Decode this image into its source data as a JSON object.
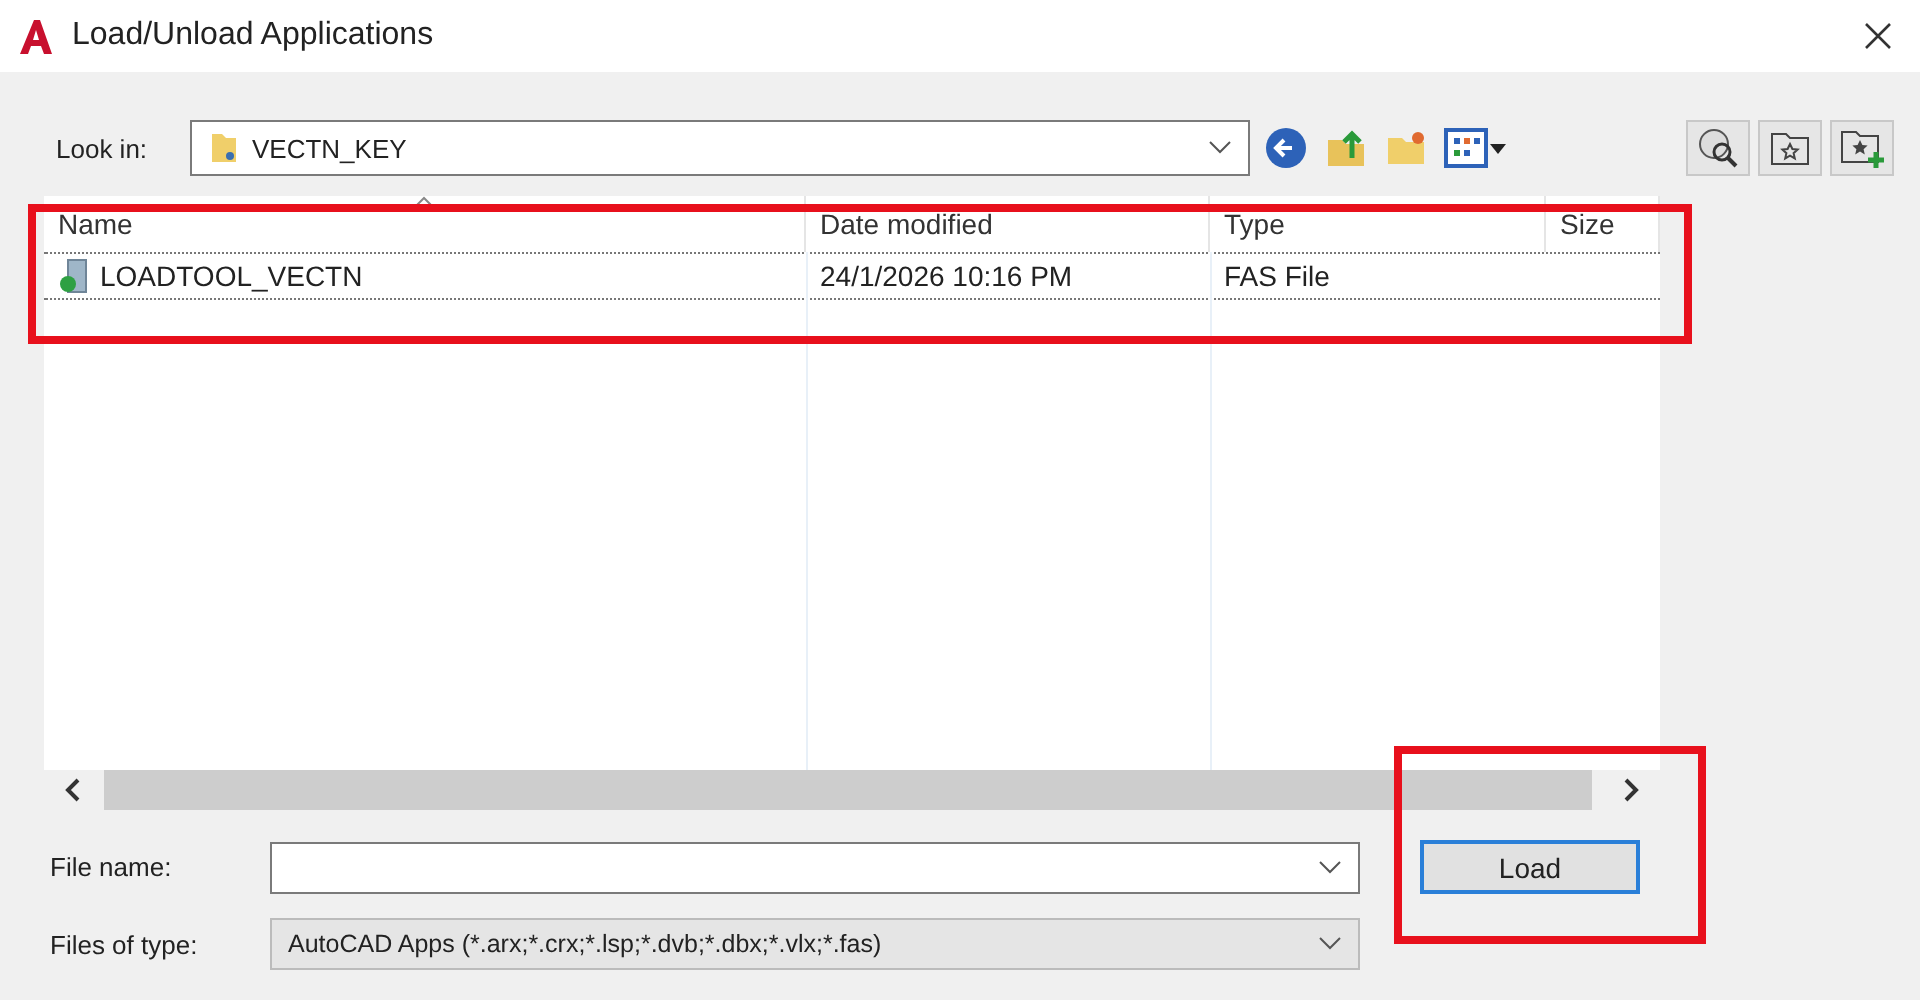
{
  "window": {
    "title": "Load/Unload Applications"
  },
  "look_in": {
    "label": "Look in:",
    "value": "VECTN_KEY"
  },
  "file_list": {
    "columns": [
      "Name",
      "Date modified",
      "Type",
      "Size"
    ],
    "rows": [
      {
        "cells": [
          "LOADTOOL_VECTN",
          "24/1/2026 10:16 PM",
          "FAS File",
          ""
        ],
        "focused": true
      }
    ]
  },
  "file_name": {
    "label": "File name:"
  },
  "files_of_type": {
    "label": "Files of type:",
    "value": "AutoCAD Apps (*.arx;*.crx;*.lsp;*.dvb;*.dbx;*.vlx;*.fas)"
  },
  "load_button": {
    "label": "Load"
  }
}
